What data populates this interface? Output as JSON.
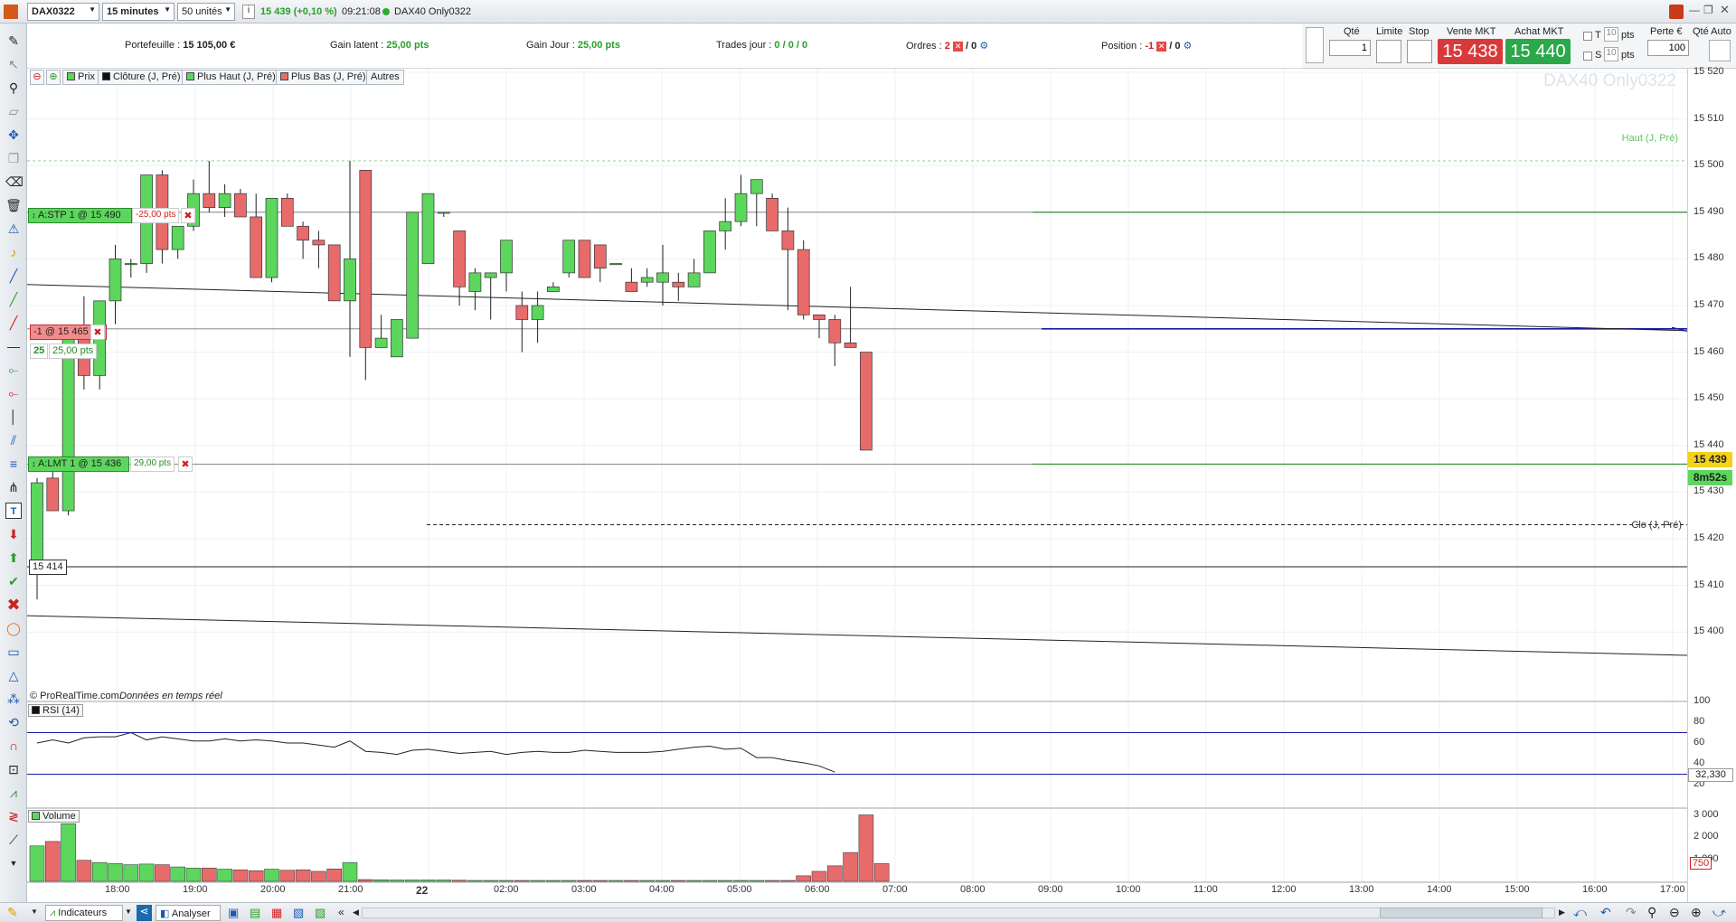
{
  "toolbar": {
    "symbol": "DAX0322",
    "timeframe": "15 minutes",
    "units": "50 unités",
    "info_icon": "i",
    "quote": "15 439 (+0,10 %)",
    "time": "09:21:08",
    "instrument": "DAX40 Only0322"
  },
  "infobar": {
    "portfolio_label": "Portefeuille :",
    "portfolio_value": "15 105,00 €",
    "latent_label": "Gain latent :",
    "latent_value": "25,00 pts",
    "day_gain_label": "Gain Jour :",
    "day_gain_value": "25,00 pts",
    "trades_label": "Trades jour :",
    "trades_value": "0 / 0 / 0",
    "orders_label": "Ordres :",
    "orders_count": "2",
    "orders_sep": "/ 0",
    "position_label": "Position :",
    "position_value": "-1",
    "position_sep": "/ 0"
  },
  "order_panel": {
    "qty_label": "Qté",
    "qty_value": "1",
    "limit_label": "Limite",
    "stop_label": "Stop",
    "sell_label": "Vente MKT",
    "sell_price": "15 438",
    "buy_label": "Achat MKT",
    "buy_price": "15 440",
    "t_label": "T",
    "t_value": "10",
    "t_unit": "pts",
    "s_label": "S",
    "s_value": "10",
    "s_unit": "pts",
    "loss_label": "Perte €",
    "loss_value": "100",
    "qty_auto_label": "Qté Auto"
  },
  "legend": {
    "price": "Prix",
    "close_prev": "Clôture (J, Pré)",
    "high_prev": "Plus Haut (J, Pré)",
    "low_prev": "Plus Bas (J, Pré)",
    "others": "Autres"
  },
  "chart": {
    "watermark": "DAX40 Only0322",
    "high_label": "Haut (J, Pré)",
    "close_label": "Clo (J, Pré)",
    "stop_order": "A:STP  1 @ 15 490",
    "stop_pts": "-25,00 pts",
    "position_tag": "-1 @ 15 465",
    "position_qty": "25",
    "position_pts": "25,00 pts",
    "limit_order": "A:LMT  1 @ 15 436",
    "limit_pts": "29,00 pts",
    "cursor_price": "15 414",
    "current_price": "15 439",
    "countdown": "8m52s",
    "copyright": "© ProRealTime.com",
    "realtime": "Données en temps réel",
    "rsi_label": "RSI (14)",
    "rsi_value": "32,330",
    "volume_label": "Volume",
    "volume_value": "750",
    "colors": {
      "up": "#5cd65c",
      "down": "#e86b6b",
      "blue_line": "#1a1aa8",
      "green_line": "#2a8a2a"
    }
  },
  "price_axis": [
    "15 520",
    "15 510",
    "15 500",
    "15 490",
    "15 480",
    "15 470",
    "15 460",
    "15 450",
    "15 440",
    "15 430",
    "15 420",
    "15 410",
    "15 400"
  ],
  "rsi_axis": [
    "100",
    "80",
    "60",
    "40",
    "20"
  ],
  "vol_axis": [
    "3 000",
    "2 000",
    "1 000"
  ],
  "time_axis": [
    "18:00",
    "19:00",
    "20:00",
    "21:00",
    "22",
    "02:00",
    "03:00",
    "04:00",
    "05:00",
    "06:00",
    "07:00",
    "08:00",
    "09:00",
    "10:00",
    "11:00",
    "12:00",
    "13:00",
    "14:00",
    "15:00",
    "16:00",
    "17:00"
  ],
  "chart_data": {
    "type": "candlestick",
    "interval": "15 minutes",
    "candles": [
      [
        15414,
        15433,
        15407,
        15432
      ],
      [
        15433,
        15437,
        15426,
        15426
      ],
      [
        15426,
        15464,
        15425,
        15464
      ],
      [
        15464,
        15472,
        15452,
        15455
      ],
      [
        15455,
        15471,
        15452,
        15471
      ],
      [
        15471,
        15483,
        15466,
        15480
      ],
      [
        15479,
        15480,
        15476,
        15479
      ],
      [
        15479,
        15498,
        15477,
        15498
      ],
      [
        15498,
        15499,
        15479,
        15482
      ],
      [
        15482,
        15487,
        15480,
        15487
      ],
      [
        15487,
        15497,
        15486,
        15494
      ],
      [
        15494,
        15501,
        15490,
        15491
      ],
      [
        15491,
        15496,
        15489,
        15494
      ],
      [
        15494,
        15495,
        15489,
        15489
      ],
      [
        15489,
        15494,
        15478,
        15476
      ],
      [
        15476,
        15493,
        15475,
        15493
      ],
      [
        15493,
        15494,
        15487,
        15487
      ],
      [
        15487,
        15488,
        15480,
        15484
      ],
      [
        15484,
        15486,
        15478,
        15483
      ],
      [
        15483,
        15483,
        15471,
        15471
      ],
      [
        15471,
        15501,
        15459,
        15480
      ],
      [
        15499,
        15499,
        15454,
        15461
      ],
      [
        15461,
        15468,
        15461,
        15463
      ],
      [
        15459,
        15467,
        15459,
        15467
      ],
      [
        15463,
        15490,
        15463,
        15490
      ],
      [
        15479,
        15494,
        15479,
        15494
      ],
      [
        15490,
        15490,
        15489,
        15490
      ],
      [
        15486,
        15486,
        15470,
        15474
      ],
      [
        15473,
        15478,
        15469,
        15477
      ],
      [
        15476,
        15477,
        15467,
        15477
      ],
      [
        15477,
        15484,
        15473,
        15484
      ],
      [
        15470,
        15473,
        15460,
        15467
      ],
      [
        15467,
        15473,
        15462,
        15470
      ],
      [
        15473,
        15475,
        15473,
        15474
      ],
      [
        15477,
        15484,
        15476,
        15484
      ],
      [
        15484,
        15484,
        15476,
        15476
      ],
      [
        15483,
        15483,
        15475,
        15478
      ],
      [
        15479,
        15479,
        15479,
        15479
      ],
      [
        15475,
        15478,
        15475,
        15473
      ],
      [
        15475,
        15478,
        15474,
        15476
      ],
      [
        15475,
        15483,
        15470,
        15477
      ],
      [
        15475,
        15477,
        15471,
        15474
      ],
      [
        15474,
        15480,
        15474,
        15477
      ],
      [
        15477,
        15486,
        15477,
        15486
      ],
      [
        15486,
        15493,
        15482,
        15488
      ],
      [
        15488,
        15498,
        15487,
        15494
      ],
      [
        15494,
        15496,
        15487,
        15497
      ],
      [
        15493,
        15494,
        15486,
        15486
      ],
      [
        15486,
        15491,
        15469,
        15482
      ],
      [
        15482,
        15484,
        15467,
        15468
      ],
      [
        15468,
        15468,
        15463,
        15467
      ],
      [
        15467,
        15468,
        15457,
        15462
      ],
      [
        15462,
        15474,
        15461,
        15461
      ],
      [
        15460,
        15460,
        15439,
        15439
      ]
    ],
    "volume": [
      1600,
      1800,
      2600,
      950,
      850,
      800,
      750,
      780,
      750,
      650,
      600,
      600,
      550,
      520,
      480,
      550,
      500,
      520,
      450,
      560,
      850,
      80,
      70,
      60,
      60,
      60,
      60,
      50,
      40,
      40,
      40,
      40,
      40,
      40,
      40,
      40,
      40,
      40,
      40,
      40,
      40,
      40,
      40,
      40,
      40,
      40,
      40,
      40,
      40,
      250,
      450,
      700,
      1300,
      3000,
      800
    ],
    "rsi": [
      60,
      63,
      60,
      65,
      66,
      66,
      70,
      63,
      66,
      64,
      62,
      62,
      64,
      62,
      63,
      62,
      60,
      60,
      58,
      56,
      62,
      52,
      51,
      49,
      53,
      54,
      52,
      50,
      51,
      52,
      49,
      51,
      52,
      51,
      51,
      53,
      52,
      51,
      51,
      51,
      52,
      54,
      56,
      57,
      54,
      55,
      46,
      46,
      43,
      41,
      38,
      32
    ],
    "levels": {
      "stop": 15490,
      "position": 15465,
      "limit": 15436,
      "prev_high": 15501,
      "prev_close": 15423,
      "cursor": 15414
    },
    "price_range": [
      15390,
      15525
    ]
  }
}
